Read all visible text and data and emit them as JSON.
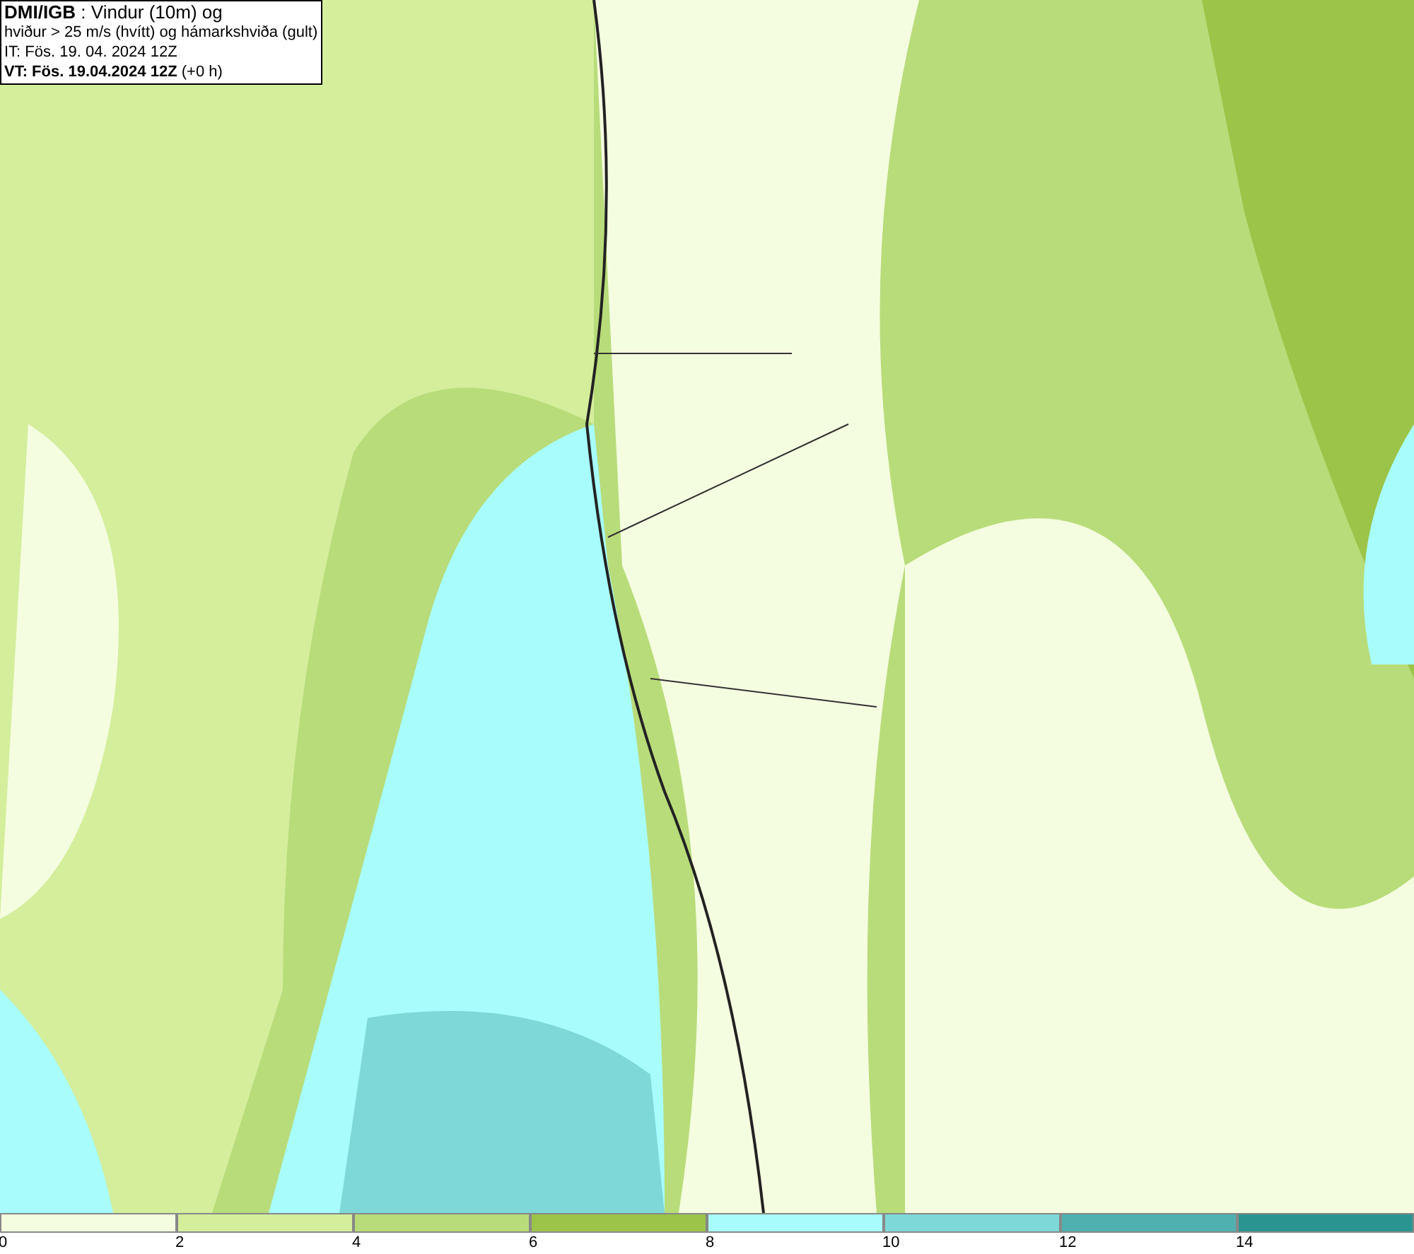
{
  "info_box": {
    "lines": [
      "**DMI/IGB** : Vindur (10m) og",
      "hviður > 25 m/s (hvítt) og hámarkshviða (gult)",
      "IT: Fös. 19. 04. 2024 12Z",
      "**VT: Fös. 19.04.2024 12Z** (+0 h)"
    ]
  },
  "legend": [
    {
      "label": "0",
      "color": "#f5fde0"
    },
    {
      "label": "2",
      "color": "#d4ee9c"
    },
    {
      "label": "4",
      "color": "#b8dc7a"
    },
    {
      "label": "6",
      "color": "#9cc448"
    },
    {
      "label": "8",
      "color": "#a8fcfc"
    },
    {
      "label": "10",
      "color": "#7fd8d8"
    },
    {
      "label": "12",
      "color": "#50b0b0"
    },
    {
      "label": "14",
      "color": "#2a9590"
    }
  ]
}
